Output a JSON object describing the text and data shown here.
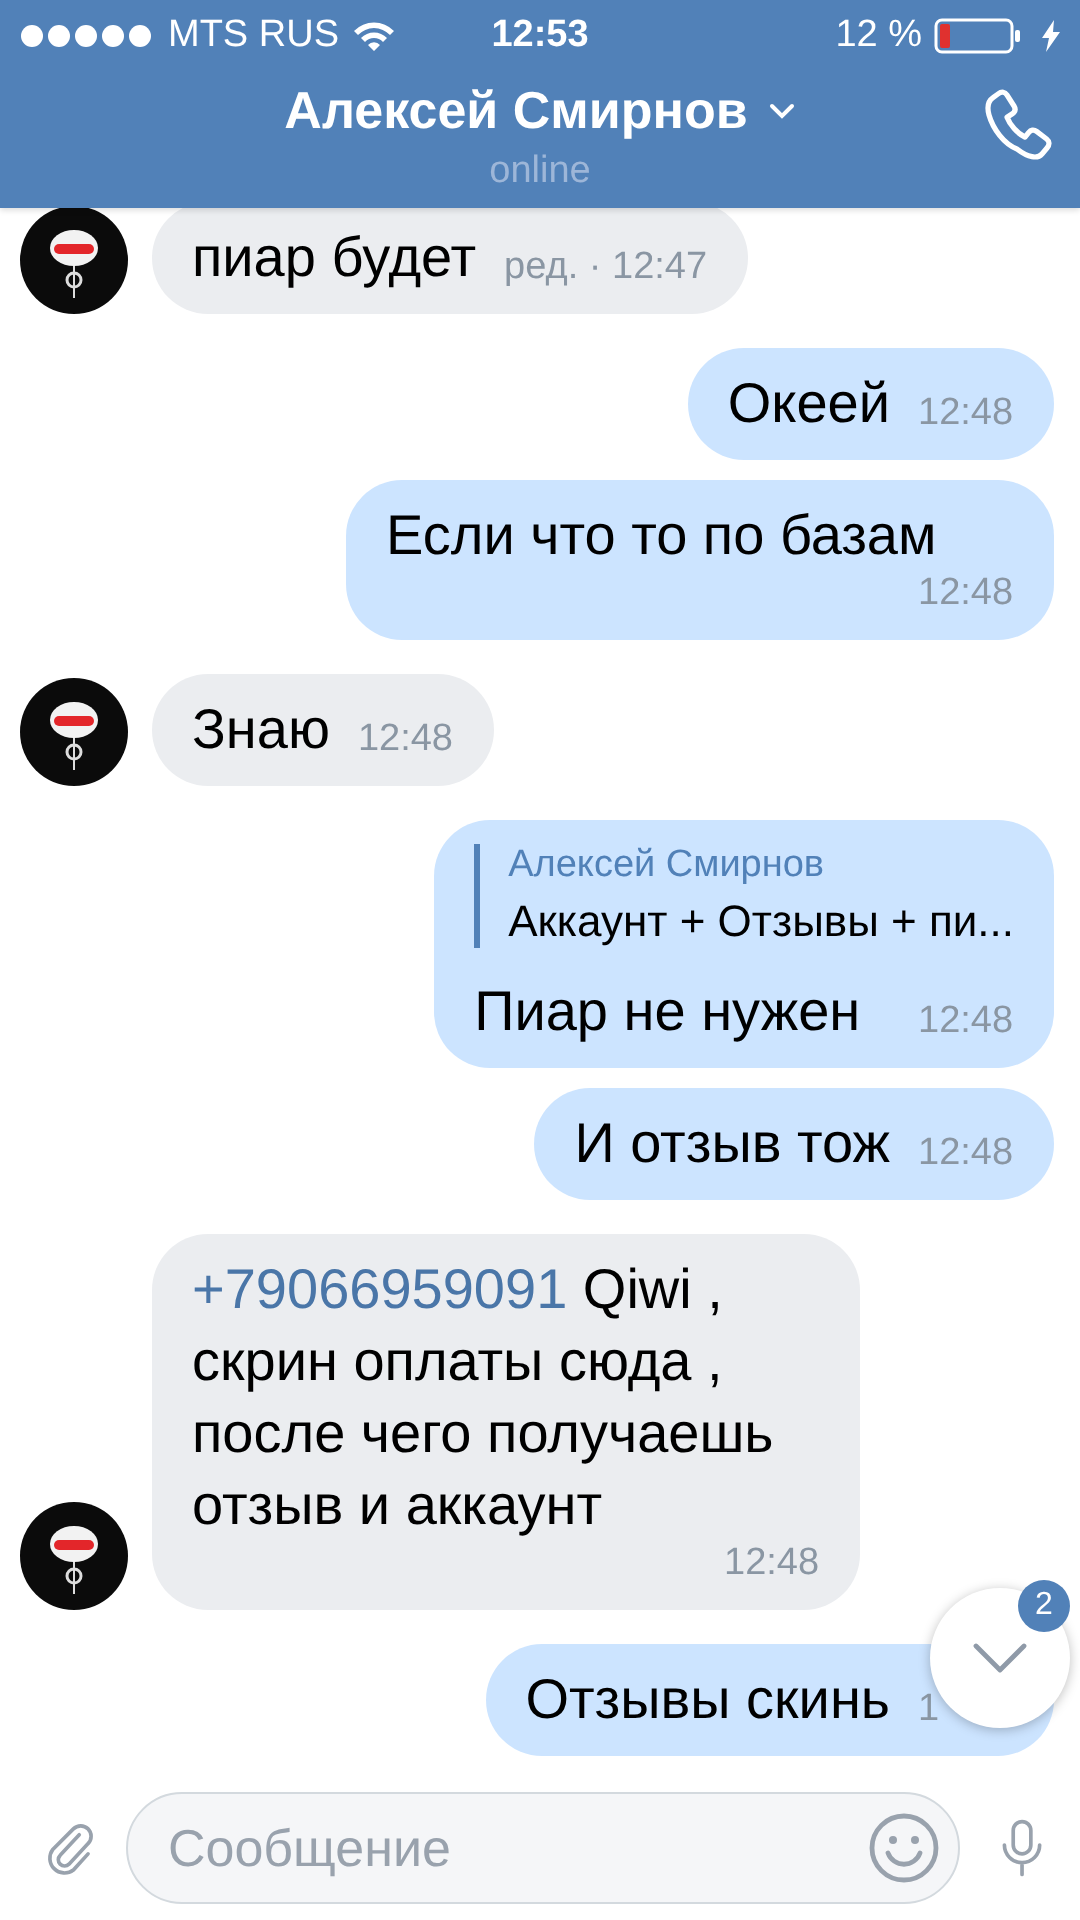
{
  "status_bar": {
    "carrier": "MTS RUS",
    "time": "12:53",
    "battery": "12 %"
  },
  "header": {
    "title": "Алексей Смирнов",
    "status": "online"
  },
  "messages": [
    {
      "kind": "incoming",
      "text": "пиар будет",
      "time": "ред. · 12:47"
    },
    {
      "kind": "outgoing",
      "text": "Океей",
      "time": "12:48"
    },
    {
      "kind": "outgoing",
      "text": "Если что то по базам",
      "time": "12:48"
    },
    {
      "kind": "incoming",
      "text": "Знаю",
      "time": "12:48"
    },
    {
      "kind": "outgoing",
      "reply": {
        "author": "Алексей Смирнов",
        "text": "Аккаунт + Отзывы + пи..."
      },
      "text": "Пиар не нужен",
      "time": "12:48"
    },
    {
      "kind": "outgoing",
      "text": "И отзыв тож",
      "time": "12:48"
    },
    {
      "kind": "incoming",
      "link": "+79066959091",
      "text": " Qiwi , скрин оплаты сюда , после чего получаешь отзыв и аккаунт",
      "time": "12:48"
    },
    {
      "kind": "outgoing",
      "text": "Отзывы скинь",
      "time": "1"
    }
  ],
  "scroll_button": {
    "badge": "2"
  },
  "composer": {
    "placeholder": "Сообщение"
  }
}
